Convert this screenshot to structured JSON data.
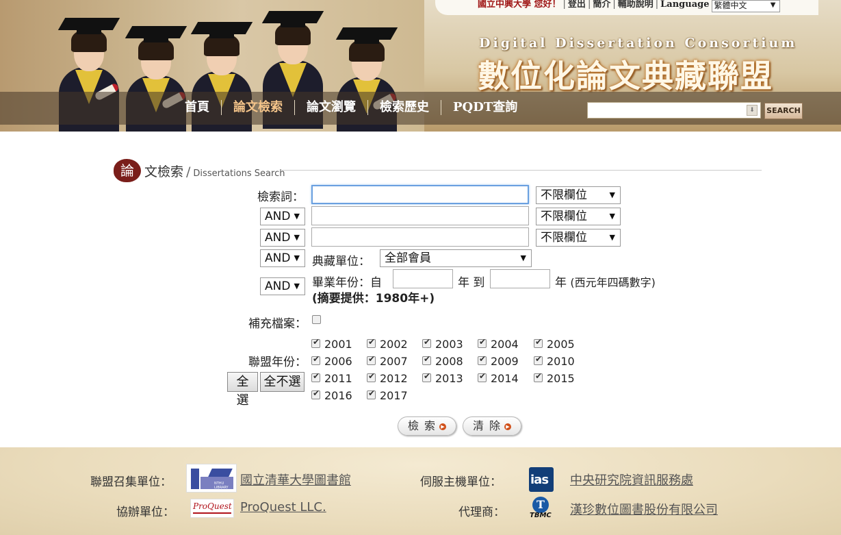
{
  "header": {
    "toplinks": {
      "greeting": "國立中興大學 您好！",
      "logout": "登出",
      "intro": "簡介",
      "help": "輔助說明",
      "language_label": "Language",
      "language_value": "繁體中文"
    },
    "brand_en": "Digital Dissertation Consortium",
    "brand_zh": "數位化論文典藏聯盟",
    "nav": [
      "首頁",
      "論文檢索",
      "論文瀏覽",
      "檢索歷史",
      "PQDT查詢"
    ],
    "search_button": "SEARCH"
  },
  "section": {
    "icon_char": "論",
    "title_zh": "文檢索",
    "title_en": "Dissertations Search"
  },
  "form": {
    "keyword_label": "檢索詞：",
    "field_option": "不限欄位",
    "bool_op": "AND",
    "collection_label": "典藏單位：",
    "collection_value": "全部會員",
    "grad_year_label": "畢業年份：自",
    "year_to": "年 到",
    "year_suffix": "年",
    "year_hint": "(西元年四碼數字)",
    "abstract_note": "(摘要提供：1980年+)",
    "supplement_label": "補充檔案：",
    "union_year_label": "聯盟年份：",
    "select_all": "全選",
    "select_none": "全不選",
    "years": [
      "2001",
      "2002",
      "2003",
      "2004",
      "2005",
      "2006",
      "2007",
      "2008",
      "2009",
      "2010",
      "2011",
      "2012",
      "2013",
      "2014",
      "2015",
      "2016",
      "2017"
    ],
    "search_btn": "檢索",
    "clear_btn": "清除"
  },
  "footer": {
    "convener_label": "聯盟召集單位：",
    "convener": "國立清華大學圖書館",
    "host_label": "伺服主機單位：",
    "host": "中央研究院資訊服務處",
    "co_label": "協辦單位：",
    "co": "ProQuest LLC.",
    "agent_label": "代理商：",
    "agent": "漢珍數位圖書股份有限公司",
    "logo_nthu_text": "NTHU LIBRARY",
    "logo_pq_text": "ProQuest",
    "logo_ias_text": "ias",
    "logo_tbmc_letter": "T",
    "logo_tbmc_text": "TBMC"
  }
}
